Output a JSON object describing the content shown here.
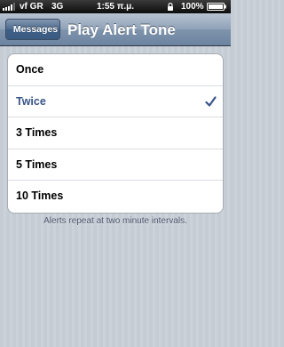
{
  "status_bar": {
    "carrier": "vf GR",
    "network": "3G",
    "time": "1:55 π.μ.",
    "battery_percent": "100%",
    "icons": [
      "signal-icon",
      "lock-icon",
      "battery-icon"
    ]
  },
  "nav": {
    "back_label": "Messages",
    "title": "Play Alert Tone"
  },
  "options": [
    {
      "label": "Once",
      "selected": false
    },
    {
      "label": "Twice",
      "selected": true
    },
    {
      "label": "3 Times",
      "selected": false
    },
    {
      "label": "5 Times",
      "selected": false
    },
    {
      "label": "10 Times",
      "selected": false
    }
  ],
  "footer_note": "Alerts repeat at two minute intervals.",
  "colors": {
    "selected_text": "#385487",
    "checkmark": "#385487",
    "nav_bar": "#6d84a2"
  }
}
